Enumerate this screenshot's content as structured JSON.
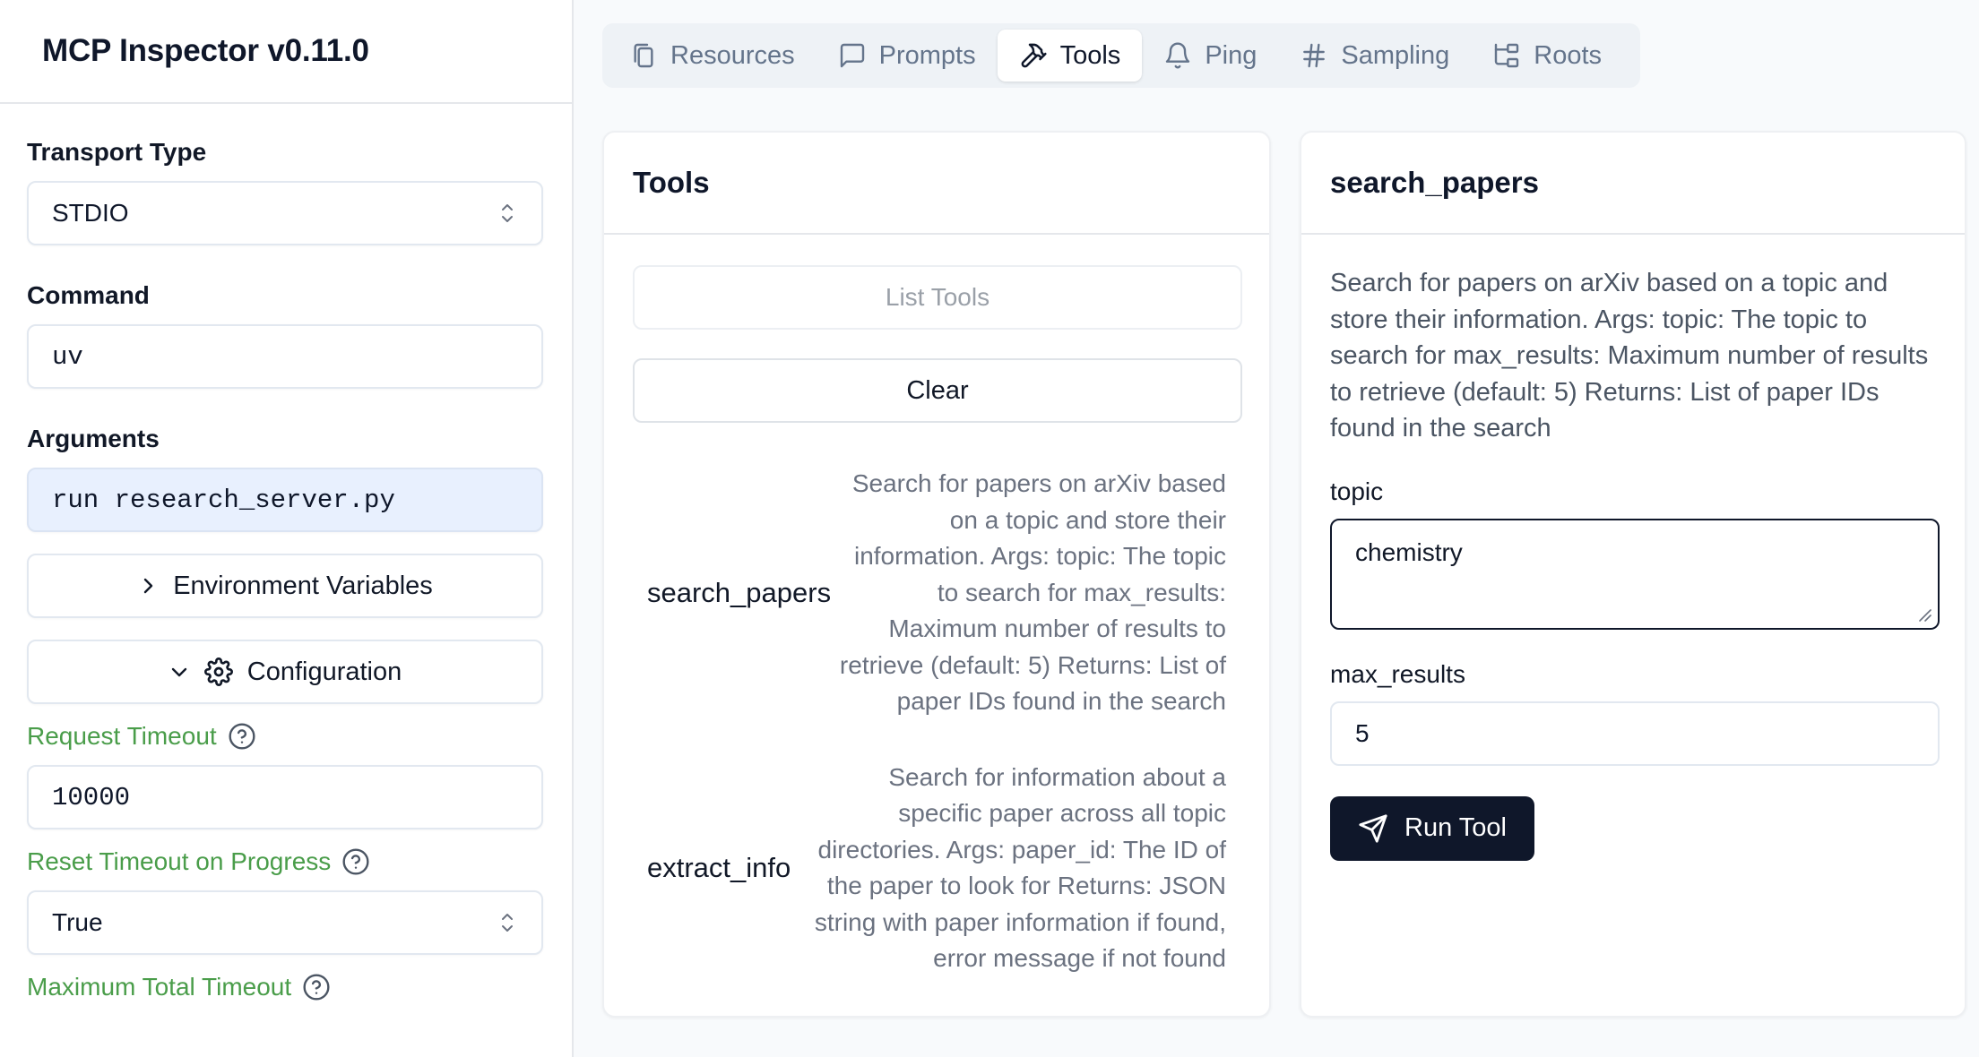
{
  "app": {
    "title": "MCP Inspector v0.11.0"
  },
  "sidebar": {
    "transport_label": "Transport Type",
    "transport_value": "STDIO",
    "command_label": "Command",
    "command_value": "uv",
    "arguments_label": "Arguments",
    "arguments_value": "run research_server.py",
    "env_vars_label": "Environment Variables",
    "configuration_label": "Configuration",
    "request_timeout_label": "Request Timeout",
    "request_timeout_value": "10000",
    "reset_timeout_label": "Reset Timeout on Progress",
    "reset_timeout_value": "True",
    "max_timeout_label": "Maximum Total Timeout"
  },
  "tabs": [
    {
      "label": "Resources",
      "icon": "files-icon",
      "active": false
    },
    {
      "label": "Prompts",
      "icon": "message-square-icon",
      "active": false
    },
    {
      "label": "Tools",
      "icon": "hammer-icon",
      "active": true
    },
    {
      "label": "Ping",
      "icon": "bell-icon",
      "active": false
    },
    {
      "label": "Sampling",
      "icon": "hash-icon",
      "active": false
    },
    {
      "label": "Roots",
      "icon": "folder-tree-icon",
      "active": false
    }
  ],
  "tools_panel": {
    "title": "Tools",
    "list_button": "List Tools",
    "clear_button": "Clear",
    "tools": [
      {
        "name": "search_papers",
        "description": "Search for papers on arXiv based on a topic and store their information. Args: topic: The topic to search for max_results: Maximum number of results to retrieve (default: 5) Returns: List of paper IDs found in the search"
      },
      {
        "name": "extract_info",
        "description": "Search for information about a specific paper across all topic directories. Args: paper_id: The ID of the paper to look for Returns: JSON string with paper information if found, error message if not found"
      }
    ]
  },
  "detail_panel": {
    "title": "search_papers",
    "description": "Search for papers on arXiv based on a topic and store their information. Args: topic: The topic to search for max_results: Maximum number of results to retrieve (default: 5) Returns: List of paper IDs found in the search",
    "topic_label": "topic",
    "topic_value": "chemistry",
    "max_results_label": "max_results",
    "max_results_value": "5",
    "run_button": "Run Tool"
  },
  "colors": {
    "accent_green": "#4a9d4a",
    "primary_dark": "#0f172a",
    "args_background": "#e8f0fe"
  }
}
